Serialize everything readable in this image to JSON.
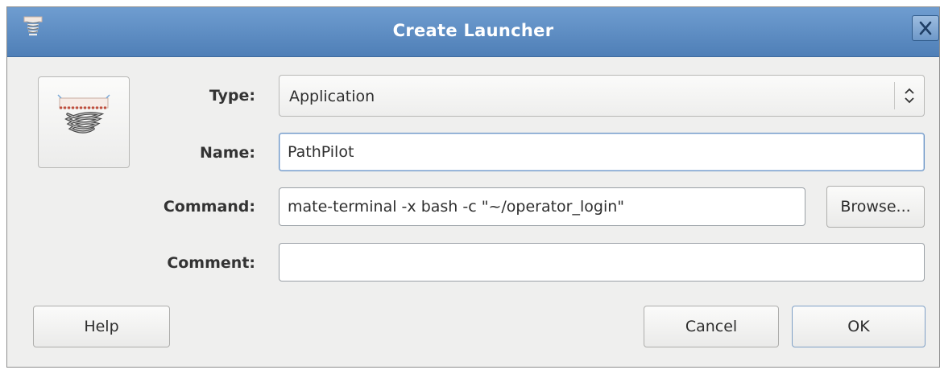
{
  "window": {
    "title": "Create Launcher"
  },
  "form": {
    "type_label": "Type:",
    "type_value": "Application",
    "name_label": "Name:",
    "name_value": "PathPilot",
    "command_label": "Command:",
    "command_value": "mate-terminal -x bash -c \"~/operator_login\"",
    "browse_label": "Browse...",
    "comment_label": "Comment:",
    "comment_value": ""
  },
  "buttons": {
    "help_label": "Help",
    "cancel_label": "Cancel",
    "ok_label": "OK"
  },
  "icons": {
    "titlebar": "launcher-spring-icon",
    "close": "close-icon",
    "launcher": "launcher-spring-icon",
    "type_dropdown": "up-down-arrows-icon"
  },
  "colors": {
    "titlebar": "#5e8ec5",
    "window_bg": "#efefee",
    "focus_border": "#6b95c6"
  }
}
